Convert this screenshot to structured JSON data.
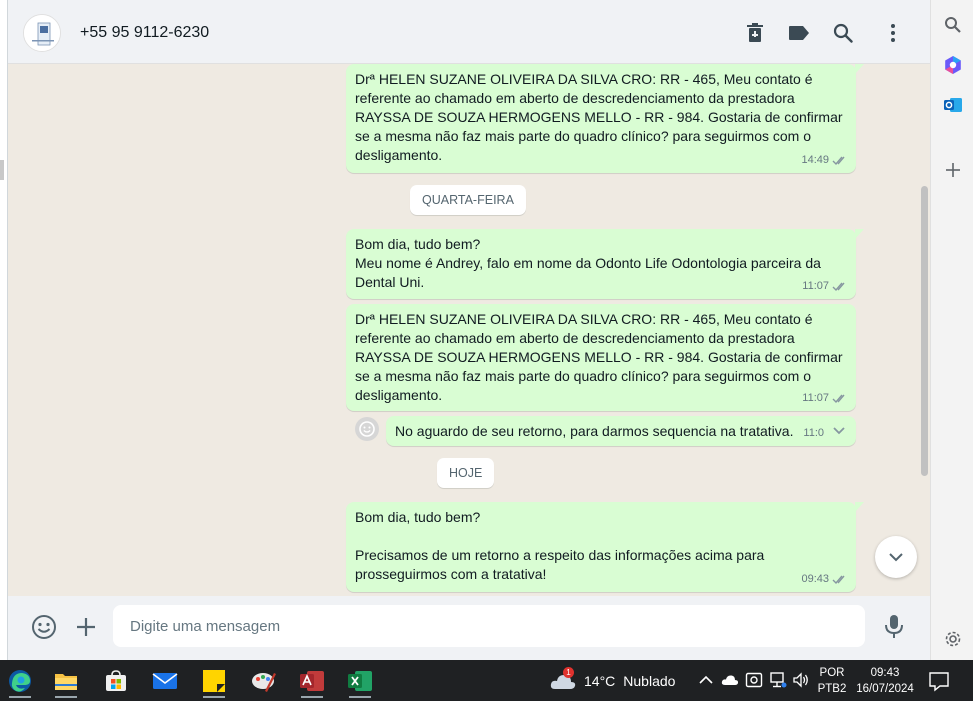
{
  "header": {
    "contact_name": "+55 95 9112-6230",
    "actions": [
      "delete-icon",
      "label-icon",
      "search-icon",
      "more-vert-icon"
    ]
  },
  "messages": [
    {
      "type": "outgoing",
      "text": "Drª HELEN SUZANE OLIVEIRA DA SILVA CRO: RR - 465, Meu contato é referente ao chamado em aberto de descredenciamento da prestadora RAYSSA DE SOUZA HERMOGENS MELLO - RR - 984. Gostaria de confirmar se a mesma não faz mais parte do quadro clínico? para seguirmos com o desligamento.",
      "time": "14:49",
      "status": "read"
    },
    {
      "type": "day",
      "label": "QUARTA-FEIRA"
    },
    {
      "type": "outgoing",
      "text": "Bom dia, tudo bem?\nMeu nome é Andrey, falo em nome da Odonto Life Odontologia parceira da Dental Uni.",
      "time": "11:07",
      "status": "read"
    },
    {
      "type": "outgoing",
      "text": "Drª HELEN SUZANE OLIVEIRA DA SILVA CRO: RR - 465, Meu contato é referente ao chamado em aberto de descredenciamento da prestadora RAYSSA DE SOUZA HERMOGENS MELLO - RR - 984. Gostaria de confirmar se a mesma não faz mais parte do quadro clínico? para seguirmos com o desligamento.",
      "time": "11:07",
      "status": "read"
    },
    {
      "type": "outgoing",
      "text": "No aguardo de seu retorno, para darmos sequencia na tratativa.",
      "time": "11:0"
    },
    {
      "type": "day",
      "label": "HOJE"
    },
    {
      "type": "outgoing",
      "text": "Bom dia, tudo bem?\n\nPrecisamos de um retorno a respeito das informações acima para prosseguirmos com a tratativa!",
      "time": "09:43",
      "status": "read"
    }
  ],
  "composer": {
    "placeholder": "Digite uma mensagem",
    "value": ""
  },
  "sidebar": {
    "items": [
      "search-icon",
      "copilot-icon",
      "outlook-icon",
      "add-icon",
      "settings-icon"
    ]
  },
  "taskbar": {
    "apps": [
      "edge-icon",
      "file-explorer-icon",
      "microsoft-store-icon",
      "mail-icon",
      "sticky-notes-icon",
      "paint-icon",
      "access-icon",
      "excel-icon"
    ],
    "weather": {
      "temp": "14°C",
      "condition": "Nublado",
      "alert_badge": "1"
    },
    "language": {
      "line1": "POR",
      "line2": "PTB2"
    },
    "clock": {
      "time": "09:43",
      "date": "16/07/2024"
    }
  },
  "colors": {
    "bubble_outgoing": "#d9fdd3",
    "chat_background": "#efeae2",
    "header_background": "#f0f2f5",
    "taskbar_background": "#1f2123"
  }
}
